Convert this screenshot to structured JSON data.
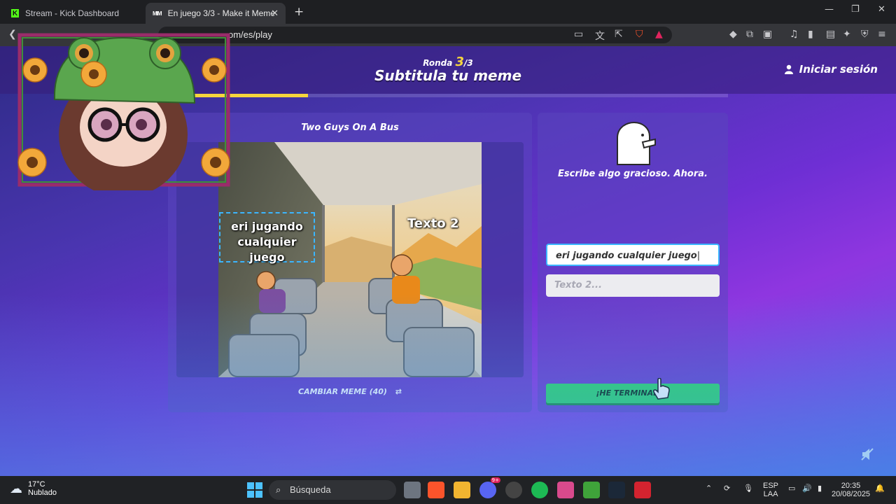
{
  "browser": {
    "tabs": [
      {
        "title": "Stream - Kick Dashboard"
      },
      {
        "title": "En juego 3/3 - Make it Meme"
      }
    ],
    "url": "om/es/play"
  },
  "header": {
    "round_label": "Ronda",
    "round_current": "3",
    "round_total": "/3",
    "title": "Subtitula tu meme",
    "login_label": "Iniciar sesión",
    "progress": 0.25
  },
  "meme": {
    "name": "Two Guys On A Bus",
    "text1": "eri jugando cualquier juego",
    "text2": "Texto 2",
    "change_label": "CAMBIAR MEME (40)"
  },
  "form": {
    "prompt": "Escribe algo gracioso. Ahora.",
    "input1_value": "eri jugando cualquier juego",
    "input2_placeholder": "Texto 2...",
    "done_label": "¡HE TERMINADO!"
  },
  "taskbar": {
    "temperature": "17°C",
    "condition": "Nublado",
    "search_placeholder": "Búsqueda",
    "lang_1": "ESP",
    "lang_2": "LAA",
    "time": "20:35",
    "date": "20/08/2025",
    "discord_badge": "9+"
  }
}
